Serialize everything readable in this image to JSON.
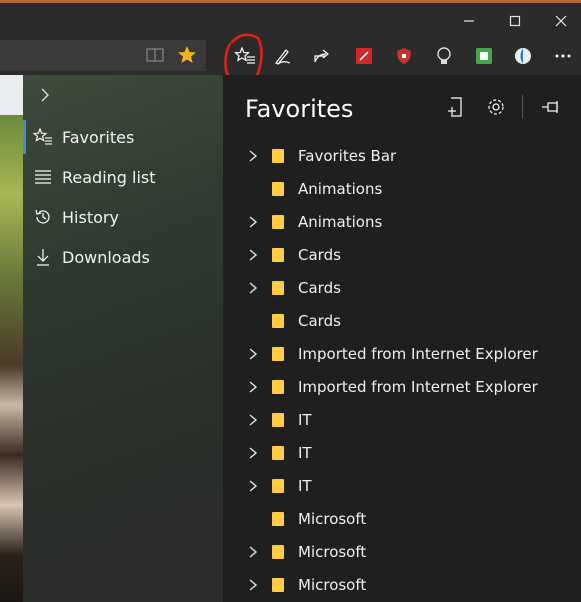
{
  "window": {
    "minimize_icon": "minimize-icon",
    "maximize_icon": "maximize-icon",
    "close_icon": "close-icon"
  },
  "toolbar": {
    "icons": [
      "reading-view-icon",
      "star-icon",
      "favorites-hub-icon",
      "pen-icon",
      "share-icon",
      "extension-red-icon",
      "shield-icon",
      "lightbulb-icon",
      "printer-icon",
      "extension-globe-icon",
      "more-icon"
    ],
    "accent_star": "#f5b21b",
    "annotation_color": "#e0201a"
  },
  "hub_nav": {
    "expand_icon": "chevron-right-icon",
    "items": [
      {
        "label": "Favorites",
        "icon": "favorites-icon",
        "selected": true
      },
      {
        "label": "Reading list",
        "icon": "reading-list-icon"
      },
      {
        "label": "History",
        "icon": "history-icon"
      },
      {
        "label": "Downloads",
        "icon": "download-icon"
      }
    ]
  },
  "favorites": {
    "title": "Favorites",
    "header_icons": [
      "add-to-favorites-icon",
      "settings-icon",
      "pin-icon"
    ],
    "folder_color": "#ffcc44",
    "items": [
      {
        "name": "Favorites Bar",
        "expandable": true
      },
      {
        "name": "Animations",
        "expandable": false
      },
      {
        "name": "Animations",
        "expandable": true
      },
      {
        "name": "Cards",
        "expandable": true
      },
      {
        "name": "Cards",
        "expandable": true
      },
      {
        "name": "Cards",
        "expandable": false
      },
      {
        "name": "Imported from Internet Explorer",
        "expandable": true
      },
      {
        "name": "Imported from Internet Explorer",
        "expandable": true
      },
      {
        "name": "IT",
        "expandable": true
      },
      {
        "name": "IT",
        "expandable": true
      },
      {
        "name": "IT",
        "expandable": true
      },
      {
        "name": "Microsoft",
        "expandable": false
      },
      {
        "name": "Microsoft",
        "expandable": true
      },
      {
        "name": "Microsoft",
        "expandable": true
      }
    ]
  }
}
